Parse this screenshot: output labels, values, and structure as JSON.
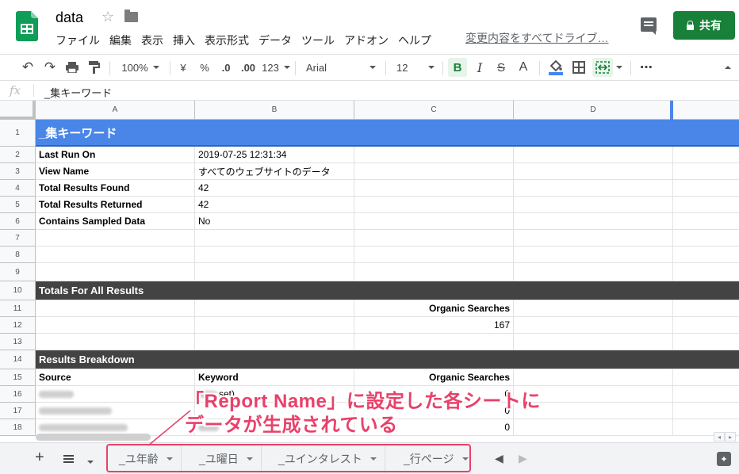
{
  "app": {
    "doc_title": "data",
    "menu": [
      "ファイル",
      "編集",
      "表示",
      "挿入",
      "表示形式",
      "データ",
      "ツール",
      "アドオン",
      "ヘルプ"
    ],
    "save_status": "変更内容をすべてドライブ…",
    "share_label": "共有",
    "brand_color": "#188038"
  },
  "toolbar": {
    "zoom": "100%",
    "currency": "¥",
    "percent": "%",
    "dec_decrease": ".0",
    "dec_increase": ".00",
    "more_formats": "123",
    "font": "Arial",
    "font_size": "12",
    "bold": "B",
    "italic": "I",
    "strike": "S",
    "text_color": "A",
    "more": "⋯"
  },
  "formula_bar": {
    "fx": "fx",
    "value": "_集キーワード"
  },
  "grid": {
    "columns": [
      "A",
      "B",
      "C",
      "D"
    ],
    "row_numbers": [
      "1",
      "2",
      "3",
      "4",
      "5",
      "6",
      "7",
      "8",
      "9",
      "10",
      "11",
      "12",
      "13",
      "14",
      "15",
      "16",
      "17",
      "18"
    ],
    "title": "_集キーワード",
    "info": [
      {
        "label": "Last Run On",
        "value": "2019-07-25 12:31:34"
      },
      {
        "label": "View Name",
        "value": "すべてのウェブサイトのデータ"
      },
      {
        "label": "Total Results Found",
        "value": "42"
      },
      {
        "label": "Total Results Returned",
        "value": "42"
      },
      {
        "label": "Contains Sampled Data",
        "value": "No"
      }
    ],
    "totals_header": "Totals For All Results",
    "totals_metric": "Organic Searches",
    "totals_value": "167",
    "breakdown_header": "Results Breakdown",
    "breakdown_columns": [
      "Source",
      "Keyword",
      "Organic Searches"
    ],
    "breakdown_rows": [
      {
        "keyword": "set)",
        "value": "0"
      },
      {
        "keyword": "",
        "value": "0"
      },
      {
        "keyword": "",
        "value": "0"
      }
    ],
    "header_color": "#4a86e8",
    "section_color": "#434343"
  },
  "sheets": {
    "tabs": [
      "_ユ年齢",
      "_ユ曜日",
      "_ユインタレスト",
      "_行ページ"
    ]
  },
  "annotation": {
    "line1": "「Report Name」に設定した各シートに",
    "line2": "データが生成されている",
    "color": "#e8416a"
  }
}
